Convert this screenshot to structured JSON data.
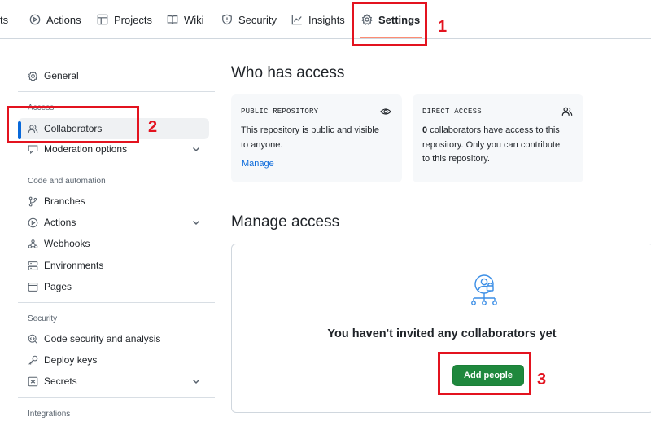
{
  "nav": {
    "tabs": [
      {
        "label": "ts",
        "icon": "graph-icon"
      },
      {
        "label": "Actions",
        "icon": "play-icon"
      },
      {
        "label": "Projects",
        "icon": "table-icon"
      },
      {
        "label": "Wiki",
        "icon": "book-icon"
      },
      {
        "label": "Security",
        "icon": "shield-icon"
      },
      {
        "label": "Insights",
        "icon": "graph-icon"
      },
      {
        "label": "Settings",
        "icon": "gear-icon"
      }
    ],
    "active_color": "#fd8c73"
  },
  "annotations": {
    "one": "1",
    "two": "2",
    "three": "3",
    "color": "#e3131f"
  },
  "sidebar": {
    "general": "General",
    "access_heading": "Access",
    "collaborators": "Collaborators",
    "moderation": "Moderation options",
    "code_heading": "Code and automation",
    "branches": "Branches",
    "actions": "Actions",
    "webhooks": "Webhooks",
    "environments": "Environments",
    "pages": "Pages",
    "security_heading": "Security",
    "code_security": "Code security and analysis",
    "deploy_keys": "Deploy keys",
    "secrets": "Secrets",
    "integrations_heading": "Integrations",
    "active_color": "#0969da"
  },
  "main": {
    "who_title": "Who has access",
    "public_card": {
      "label": "PUBLIC REPOSITORY",
      "line1": "This repository is public and visible",
      "line2": "to anyone.",
      "link": "Manage"
    },
    "direct_card": {
      "label": "DIRECT ACCESS",
      "count": "0",
      "line1": "collaborators have access to this",
      "line2": "repository. Only you can contribute",
      "line3": "to this repository."
    },
    "manage_title": "Manage access",
    "empty_message": "You haven't invited any collaborators yet",
    "add_button": "Add people",
    "add_button_color": "#1f883d"
  }
}
